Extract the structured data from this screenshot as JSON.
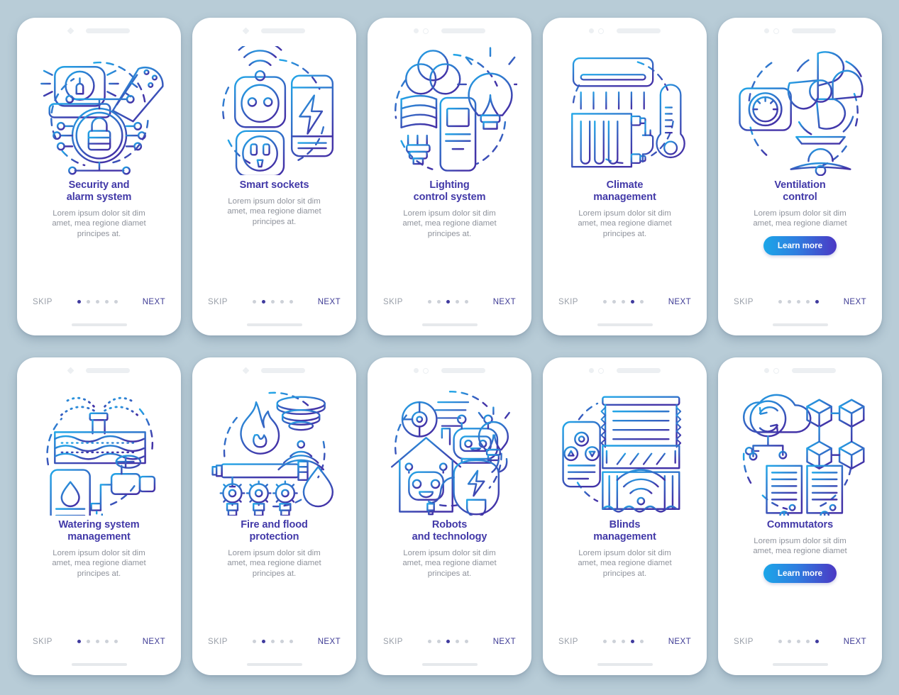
{
  "meta": {
    "background_color": "#b8ccd7",
    "card_background": "#ffffff",
    "title_color": "#4239a8",
    "desc_color": "#8f939c",
    "skip_color": "#9aa0a9",
    "next_color": "#3d3a94",
    "dot_active_color": "#3f3a9e",
    "dot_inactive_color": "#cdd1d8",
    "button_gradient_from": "#1ba6e8",
    "button_gradient_to": "#4b38c4"
  },
  "labels": {
    "skip": "SKIP",
    "next": "NEXT",
    "learn_more": "Learn more"
  },
  "screens": [
    {
      "id": "security-alarm-system",
      "title": "Security and\nalarm system",
      "title_lines": [
        "Security and",
        "alarm system"
      ],
      "description": "Lorem ipsum dolor sit dim amet, mea regione diamet principes at.",
      "desc_lines": [
        "Lorem ipsum dolor sit dim",
        "amet, mea regione diamet",
        "principes at."
      ],
      "icon": "security-alarm-icon",
      "status_icons": [
        "diamond-camera-icon",
        "speaker-bar-icon"
      ],
      "dots": 5,
      "active_dot": 1,
      "has_learn_more": false
    },
    {
      "id": "smart-sockets",
      "title": "Smart sockets",
      "title_lines": [
        "Smart sockets"
      ],
      "description": "Lorem ipsum dolor sit dim amet, mea regione diamet principes at.",
      "desc_lines": [
        "Lorem ipsum dolor sit dim",
        "amet, mea regione diamet",
        "principes at."
      ],
      "icon": "smart-socket-icon",
      "status_icons": [
        "diamond-camera-icon",
        "speaker-bar-icon"
      ],
      "dots": 5,
      "active_dot": 2,
      "has_learn_more": false
    },
    {
      "id": "lighting-control-system",
      "title": "Lighting\ncontrol system",
      "title_lines": [
        "Lighting",
        "control system"
      ],
      "description": "Lorem ipsum dolor sit dim amet, mea regione diamet principes at.",
      "desc_lines": [
        "Lorem ipsum dolor sit dim",
        "amet, mea regione diamet",
        "principes at."
      ],
      "icon": "lighting-control-icon",
      "status_icons": [
        "dot-camera-icon",
        "ring-camera-icon",
        "speaker-bar-icon"
      ],
      "dots": 5,
      "active_dot": 3,
      "has_learn_more": false
    },
    {
      "id": "climate-management",
      "title": "Climate\nmanagement",
      "title_lines": [
        "Climate",
        "management"
      ],
      "description": "Lorem ipsum dolor sit dim amet, mea regione diamet principes at.",
      "desc_lines": [
        "Lorem ipsum dolor sit dim",
        "amet, mea regione diamet",
        "principes at."
      ],
      "icon": "climate-management-icon",
      "status_icons": [
        "dot-camera-icon",
        "ring-camera-icon",
        "speaker-bar-icon"
      ],
      "dots": 5,
      "active_dot": 4,
      "has_learn_more": false
    },
    {
      "id": "ventilation-control",
      "title": "Ventilation\ncontrol",
      "title_lines": [
        "Ventilation",
        "control"
      ],
      "description": "Lorem ipsum dolor sit dim amet, mea regione diamet",
      "desc_lines": [
        "Lorem ipsum dolor sit dim",
        "amet, mea regione diamet"
      ],
      "icon": "ventilation-control-icon",
      "status_icons": [
        "dot-camera-icon",
        "ring-camera-icon",
        "speaker-bar-icon"
      ],
      "dots": 5,
      "active_dot": 5,
      "has_learn_more": true
    },
    {
      "id": "watering-system-management",
      "title": "Watering system\nmanagement",
      "title_lines": [
        "Watering system",
        "management"
      ],
      "description": "Lorem ipsum dolor sit dim amet, mea regione diamet principes at.",
      "desc_lines": [
        "Lorem ipsum dolor sit dim",
        "amet, mea regione diamet",
        "principes at."
      ],
      "icon": "watering-system-icon",
      "status_icons": [
        "diamond-camera-icon",
        "speaker-bar-icon"
      ],
      "dots": 5,
      "active_dot": 1,
      "has_learn_more": false
    },
    {
      "id": "fire-flood-protection",
      "title": "Fire and flood\nprotection",
      "title_lines": [
        "Fire and flood",
        "protection"
      ],
      "description": "Lorem ipsum dolor sit dim amet, mea regione diamet principes at.",
      "desc_lines": [
        "Lorem ipsum dolor sit dim",
        "amet, mea regione diamet",
        "principes at."
      ],
      "icon": "fire-flood-icon",
      "status_icons": [
        "diamond-camera-icon",
        "speaker-bar-icon"
      ],
      "dots": 5,
      "active_dot": 2,
      "has_learn_more": false
    },
    {
      "id": "robots-and-technology",
      "title": "Robots\nand technology",
      "title_lines": [
        "Robots",
        "and technology"
      ],
      "description": "Lorem ipsum dolor sit dim amet, mea regione diamet principes at.",
      "desc_lines": [
        "Lorem ipsum dolor sit dim",
        "amet, mea regione diamet",
        "principes at."
      ],
      "icon": "robot-technology-icon",
      "status_icons": [
        "dot-camera-icon",
        "ring-camera-icon",
        "speaker-bar-icon"
      ],
      "dots": 5,
      "active_dot": 3,
      "has_learn_more": false
    },
    {
      "id": "blinds-management",
      "title": "Blinds\nmanagement",
      "title_lines": [
        "Blinds",
        "management"
      ],
      "description": "Lorem ipsum dolor sit dim amet, mea regione diamet principes at.",
      "desc_lines": [
        "Lorem ipsum dolor sit dim",
        "amet, mea regione diamet",
        "principes at."
      ],
      "icon": "blinds-management-icon",
      "status_icons": [
        "dot-camera-icon",
        "ring-camera-icon",
        "speaker-bar-icon"
      ],
      "dots": 5,
      "active_dot": 4,
      "has_learn_more": false
    },
    {
      "id": "commutators",
      "title": "Commutators",
      "title_lines": [
        "Commutators"
      ],
      "description": "Lorem ipsum dolor sit dim amet, mea regione diamet",
      "desc_lines": [
        "Lorem ipsum dolor sit dim",
        "amet, mea regione diamet"
      ],
      "icon": "commutators-icon",
      "status_icons": [
        "dot-camera-icon",
        "ring-camera-icon",
        "speaker-bar-icon"
      ],
      "dots": 5,
      "active_dot": 5,
      "has_learn_more": true
    }
  ]
}
